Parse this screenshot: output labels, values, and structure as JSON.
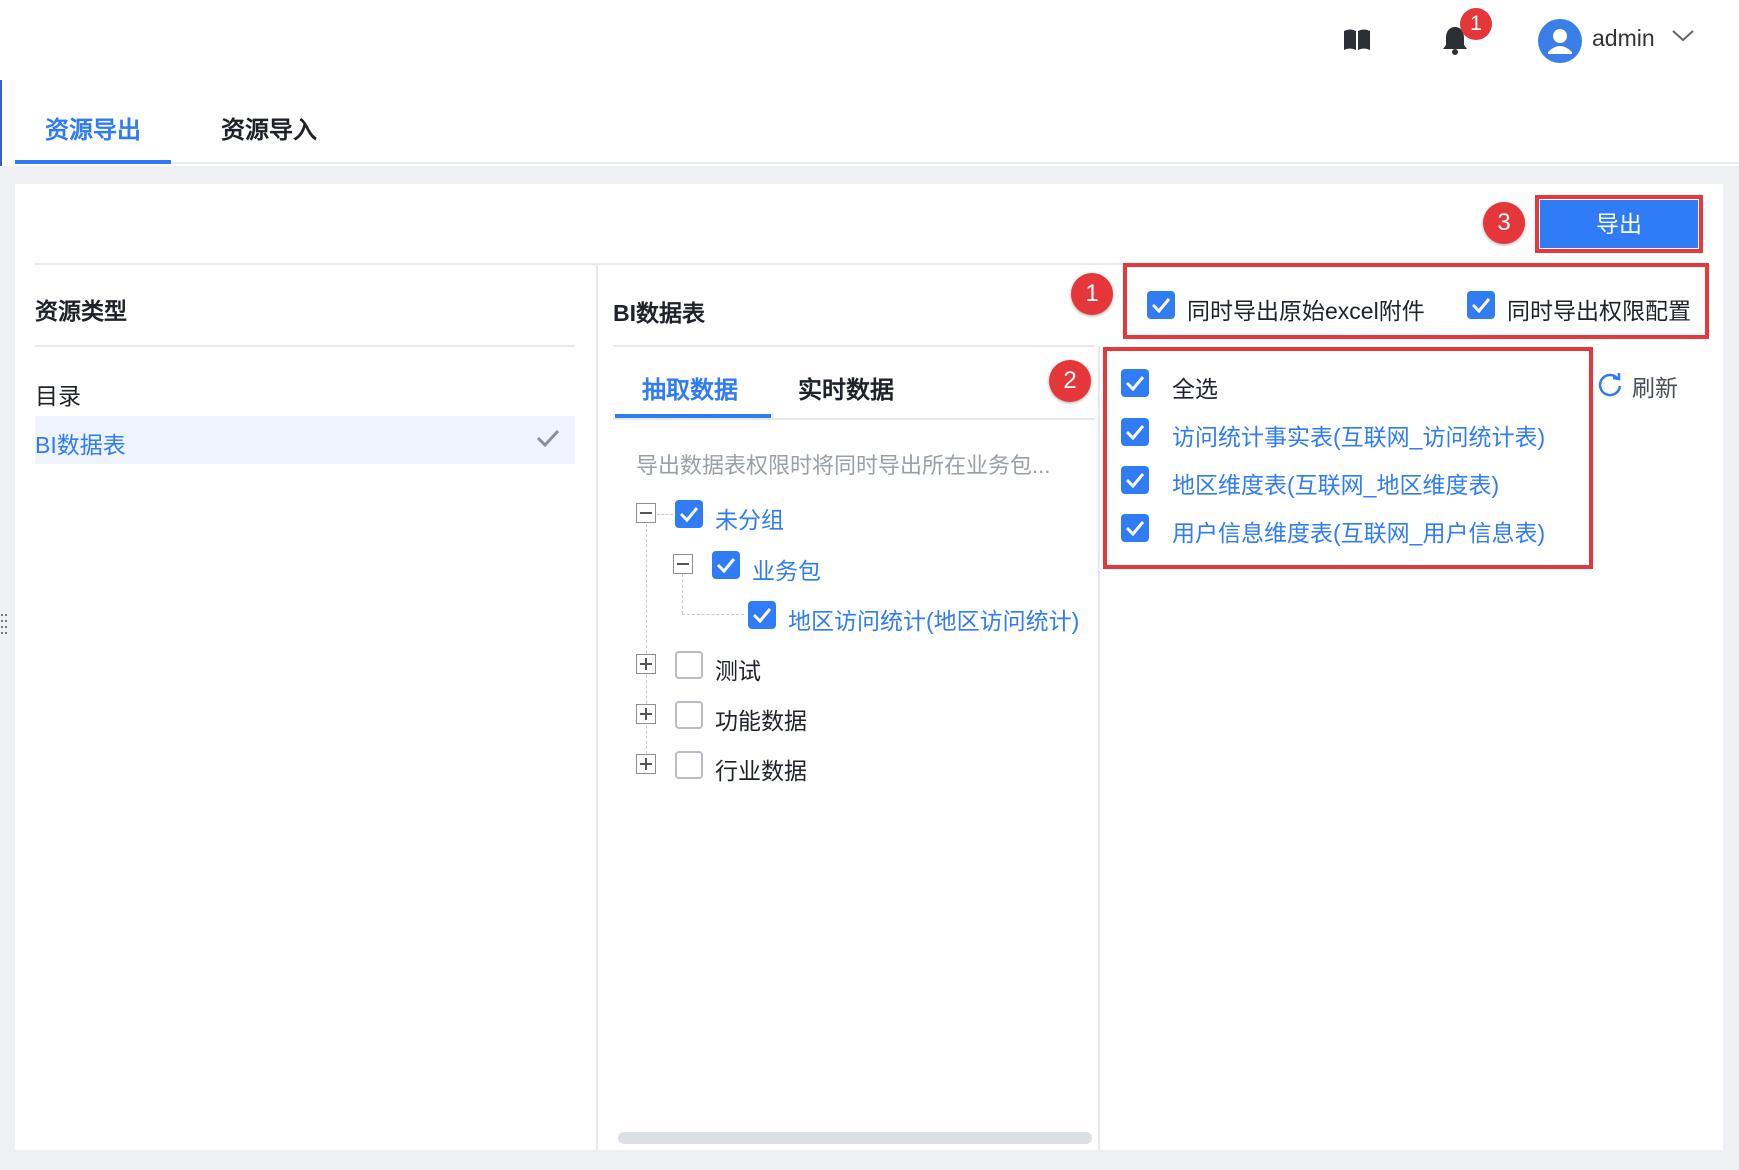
{
  "header": {
    "badge_count": "1",
    "username": "admin",
    "icons": {
      "book": "book-icon",
      "bell": "bell-icon",
      "avatar": "user-avatar-icon",
      "chevron": "chevron-down-icon"
    }
  },
  "tabs": [
    {
      "label": "资源导出",
      "active": true
    },
    {
      "label": "资源导入",
      "active": false
    }
  ],
  "toolbar": {
    "export_label": "导出"
  },
  "callouts": [
    "1",
    "2",
    "3"
  ],
  "resource_type": {
    "heading": "资源类型",
    "items": [
      {
        "label": "目录",
        "selected": false
      },
      {
        "label": "BI数据表",
        "selected": true
      }
    ]
  },
  "bi_table": {
    "heading": "BI数据表",
    "sub_tabs": [
      {
        "label": "抽取数据",
        "active": true
      },
      {
        "label": "实时数据",
        "active": false
      }
    ],
    "hint": "导出数据表权限时将同时导出所在业务包...",
    "tree": [
      {
        "label": "未分组",
        "checked": true,
        "expanded": true
      },
      {
        "label": "业务包",
        "checked": true,
        "expanded": true
      },
      {
        "label": "地区访问统计(地区访问统计)",
        "checked": true
      },
      {
        "label": "测试",
        "checked": false,
        "expanded": false
      },
      {
        "label": "功能数据",
        "checked": false,
        "expanded": false
      },
      {
        "label": "行业数据",
        "checked": false,
        "expanded": false
      }
    ]
  },
  "export_options": [
    {
      "label": "同时导出原始excel附件",
      "checked": true
    },
    {
      "label": "同时导出权限配置",
      "checked": true
    }
  ],
  "selection": {
    "select_all_label": "全选",
    "select_all_checked": true,
    "refresh_label": "刷新",
    "items": [
      {
        "label": "访问统计事实表(互联网_访问统计表)",
        "checked": true
      },
      {
        "label": "地区维度表(互联网_地区维度表)",
        "checked": true
      },
      {
        "label": "用户信息维度表(互联网_用户信息表)",
        "checked": true
      }
    ]
  },
  "colors": {
    "accent": "#2f7cf6",
    "annotation_red": "#e4393c",
    "selected_bg": "#eef3fd"
  }
}
